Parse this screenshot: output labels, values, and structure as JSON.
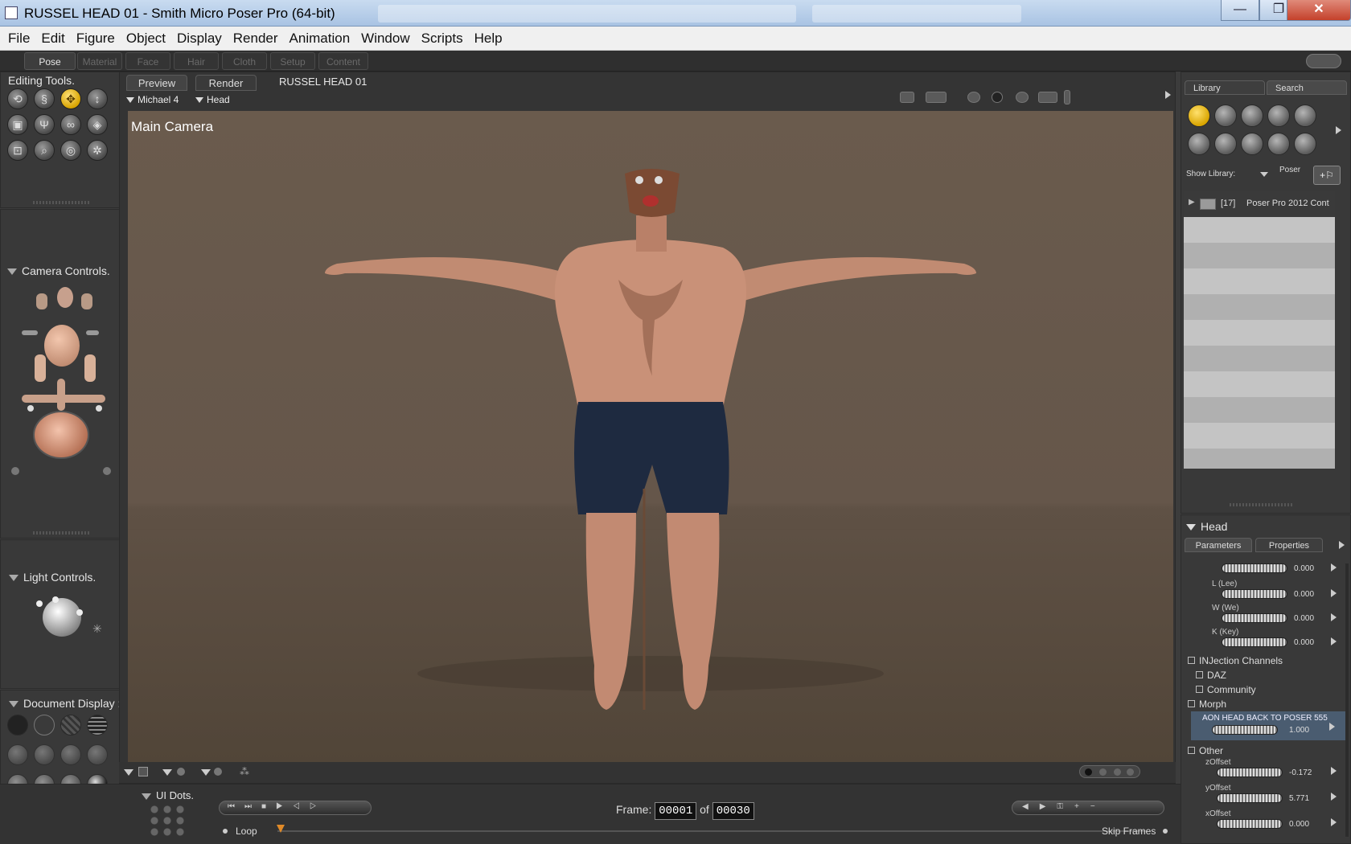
{
  "window": {
    "title": "RUSSEL HEAD 01 - Smith Micro Poser Pro  (64-bit)",
    "controls": [
      "—",
      "❐",
      "✕"
    ]
  },
  "menu": [
    "File",
    "Edit",
    "Figure",
    "Object",
    "Display",
    "Render",
    "Animation",
    "Window",
    "Scripts",
    "Help"
  ],
  "rooms": [
    "Pose",
    "Material",
    "Face",
    "Hair",
    "Cloth",
    "Setup",
    "Content"
  ],
  "editing_tools": {
    "title": "Editing Tools.",
    "icons": [
      "rotate-icon",
      "twist-icon",
      "translate-icon",
      "translate-in-out-icon",
      "scale-icon",
      "taper-icon",
      "chain-break-icon",
      "color-icon",
      "grouping-icon",
      "view-magnifier-icon",
      "morphing-tool-icon",
      "direct-manipulation-icon"
    ]
  },
  "camera_controls": {
    "title": "Camera Controls."
  },
  "light_controls": {
    "title": "Light Controls."
  },
  "document_display": {
    "title": "Document Display :"
  },
  "viewport": {
    "tabs": [
      "Preview",
      "Render"
    ],
    "doc_name": "RUSSEL HEAD 01",
    "figure_menu": "Michael 4",
    "actor_menu": "Head",
    "camera_label": "Main Camera"
  },
  "ui_dots": {
    "title": "UI Dots."
  },
  "animation": {
    "frame_label": "Frame:",
    "frame_current": "00001",
    "of_label": "of",
    "frame_total": "00030",
    "loop_label": "Loop",
    "skip_frames_label": "Skip Frames"
  },
  "library": {
    "tabs": [
      "Library",
      "Search"
    ],
    "show_library_label": "Show Library:",
    "show_library_value": "Poser",
    "folder_count": "[17]",
    "folder_name": "Poser Pro 2012 Cont"
  },
  "parameters": {
    "actor": "Head",
    "tabs": [
      "Parameters",
      "Properties"
    ],
    "dials": [
      {
        "label": "",
        "value": "0.000"
      },
      {
        "label": "L (Lee)",
        "value": "0.000"
      },
      {
        "label": "W (We)",
        "value": "0.000"
      },
      {
        "label": "K (Key)",
        "value": "0.000"
      }
    ],
    "groups": [
      "INJection Channels",
      "DAZ",
      "Community",
      "Morph"
    ],
    "morph": {
      "label": "AON HEAD BACK TO POSER 555",
      "value": "1.000"
    },
    "other_group": "Other",
    "other_dials": [
      {
        "label": "zOffset",
        "value": "-0.172"
      },
      {
        "label": "yOffset",
        "value": "5.771"
      },
      {
        "label": "xOffset",
        "value": "0.000"
      }
    ]
  }
}
